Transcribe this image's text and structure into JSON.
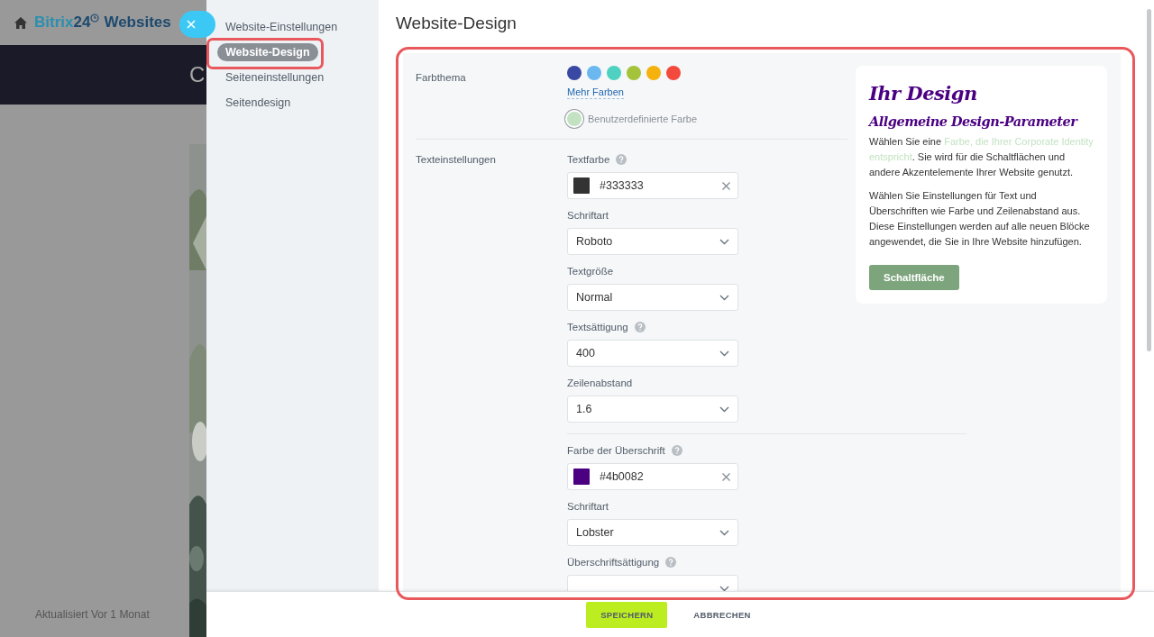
{
  "background_page": {
    "logo": {
      "part1": "Bitrix",
      "part2": "24",
      "part3": "Websites"
    },
    "banner_text": "C",
    "updated": "Aktualisiert Vor 1 Monat"
  },
  "sidebar": {
    "items": [
      {
        "label": "Website-Einstellungen",
        "selected": false
      },
      {
        "label": "Website-Design",
        "selected": true
      },
      {
        "label": "Seiteneinstellungen",
        "selected": false
      },
      {
        "label": "Seitendesign",
        "selected": false
      }
    ]
  },
  "title": "Website-Design",
  "color_theme": {
    "label": "Farbthema",
    "swatches": [
      {
        "color": "#3949a3",
        "selected": false
      },
      {
        "color": "#6ab8ef",
        "selected": false
      },
      {
        "color": "#4fd1c1",
        "selected": false
      },
      {
        "color": "#a4c23a",
        "selected": false
      },
      {
        "color": "#f6b20c",
        "selected": false
      },
      {
        "color": "#f44a3e",
        "selected": false
      }
    ],
    "more_link": "Mehr Farben",
    "custom": {
      "label": "Benutzerdefinierte Farbe",
      "color": "#c3e2c2",
      "selected": true
    }
  },
  "text_settings": {
    "label": "Texteinstellungen",
    "fields": [
      {
        "kind": "color",
        "label": "Textfarbe",
        "help": true,
        "value": "#333333",
        "color": "#333333"
      },
      {
        "kind": "select",
        "label": "Schriftart",
        "help": false,
        "value": "Roboto"
      },
      {
        "kind": "select",
        "label": "Textgröße",
        "help": false,
        "value": "Normal"
      },
      {
        "kind": "select",
        "label": "Textsättigung",
        "help": true,
        "value": "400"
      },
      {
        "kind": "select",
        "label": "Zeilenabstand",
        "help": false,
        "value": "1.6"
      },
      {
        "kind": "divider"
      },
      {
        "kind": "color",
        "label": "Farbe der Überschrift",
        "help": true,
        "value": "#4b0082",
        "color": "#4b0082"
      },
      {
        "kind": "select",
        "label": "Schriftart",
        "help": false,
        "value": "Lobster"
      },
      {
        "kind": "select",
        "label": "Überschriftsättigung",
        "help": true
      }
    ]
  },
  "preview": {
    "title": "Ihr Design",
    "subtitle": "Allgemeine Design-Parameter",
    "paragraph_1": {
      "before": "Wählen Sie eine ",
      "accent": "Farbe, die Ihrer Corporate Identity entspricht",
      "after": ". Sie wird für die Schaltflächen und andere Akzentelemente Ihrer Website genutzt."
    },
    "paragraph_2": "Wählen Sie Einstellungen für Text und Überschriften wie Farbe und Zeilenabstand aus. Diese Einstellungen werden auf alle neuen Blöcke angewendet, die Sie in Ihre Website hinzufügen.",
    "button": "Schaltfläche"
  },
  "footer": {
    "buttons": [
      {
        "kind": "primary",
        "label": "SPEICHERN"
      },
      {
        "kind": "secondary",
        "label": "ABBRECHEN"
      }
    ]
  }
}
